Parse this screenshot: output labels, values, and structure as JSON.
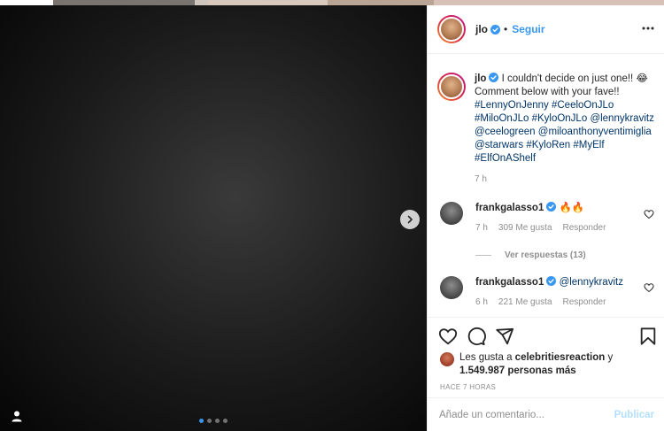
{
  "colors": {
    "accent": "#3897f0",
    "hashtag": "#003569",
    "muted": "#8e8e8e",
    "publish_disabled": "#b2dffc",
    "media_background": "#000000"
  },
  "media": {
    "placeholder_note": "",
    "carousel": {
      "current": 1,
      "total": 4
    }
  },
  "header": {
    "username": "jlo",
    "separator": "•",
    "follow_label": "Seguir"
  },
  "caption": {
    "username": "jlo",
    "text_lead": "I couldn't decide on just one!!",
    "emoji": "😂",
    "text_tail": "Comment below with your fave!!",
    "tags": [
      "#LennyOnJenny",
      "#CeeloOnJLo",
      "#MiloOnJLo",
      "#KyloOnJLo",
      "@lennykravitz",
      "@ceelogreen",
      "@miloanthonyventimiglia",
      "@starwars",
      "#KyloRen",
      "#MyElf",
      "#ElfOnAShelf"
    ],
    "time": "7 h"
  },
  "comments": [
    {
      "username": "frankgalasso1",
      "text": "🔥🔥",
      "time": "7 h",
      "likes": "309 Me gusta",
      "reply": "Responder"
    },
    {
      "username": "frankgalasso1",
      "text": "@lennykravitz",
      "time": "6 h",
      "likes": "221 Me gusta",
      "reply": "Responder"
    }
  ],
  "view_replies": "Ver respuestas (13)",
  "likes": {
    "prefix": "Les gusta a",
    "user": "celebritiesreaction",
    "connector": "y",
    "count": "1.549.987 personas más"
  },
  "post_age": "HACE 7 HORAS",
  "add_comment": {
    "placeholder": "Añade un comentario...",
    "publish": "Publicar"
  },
  "icons": {
    "next": "chevron-right-icon",
    "verified": "verified-badge-icon",
    "more": "more-options-icon",
    "heart": "heart-icon",
    "comment": "comment-icon",
    "share": "share-icon",
    "save": "bookmark-icon",
    "tag": "user-tag-icon"
  }
}
